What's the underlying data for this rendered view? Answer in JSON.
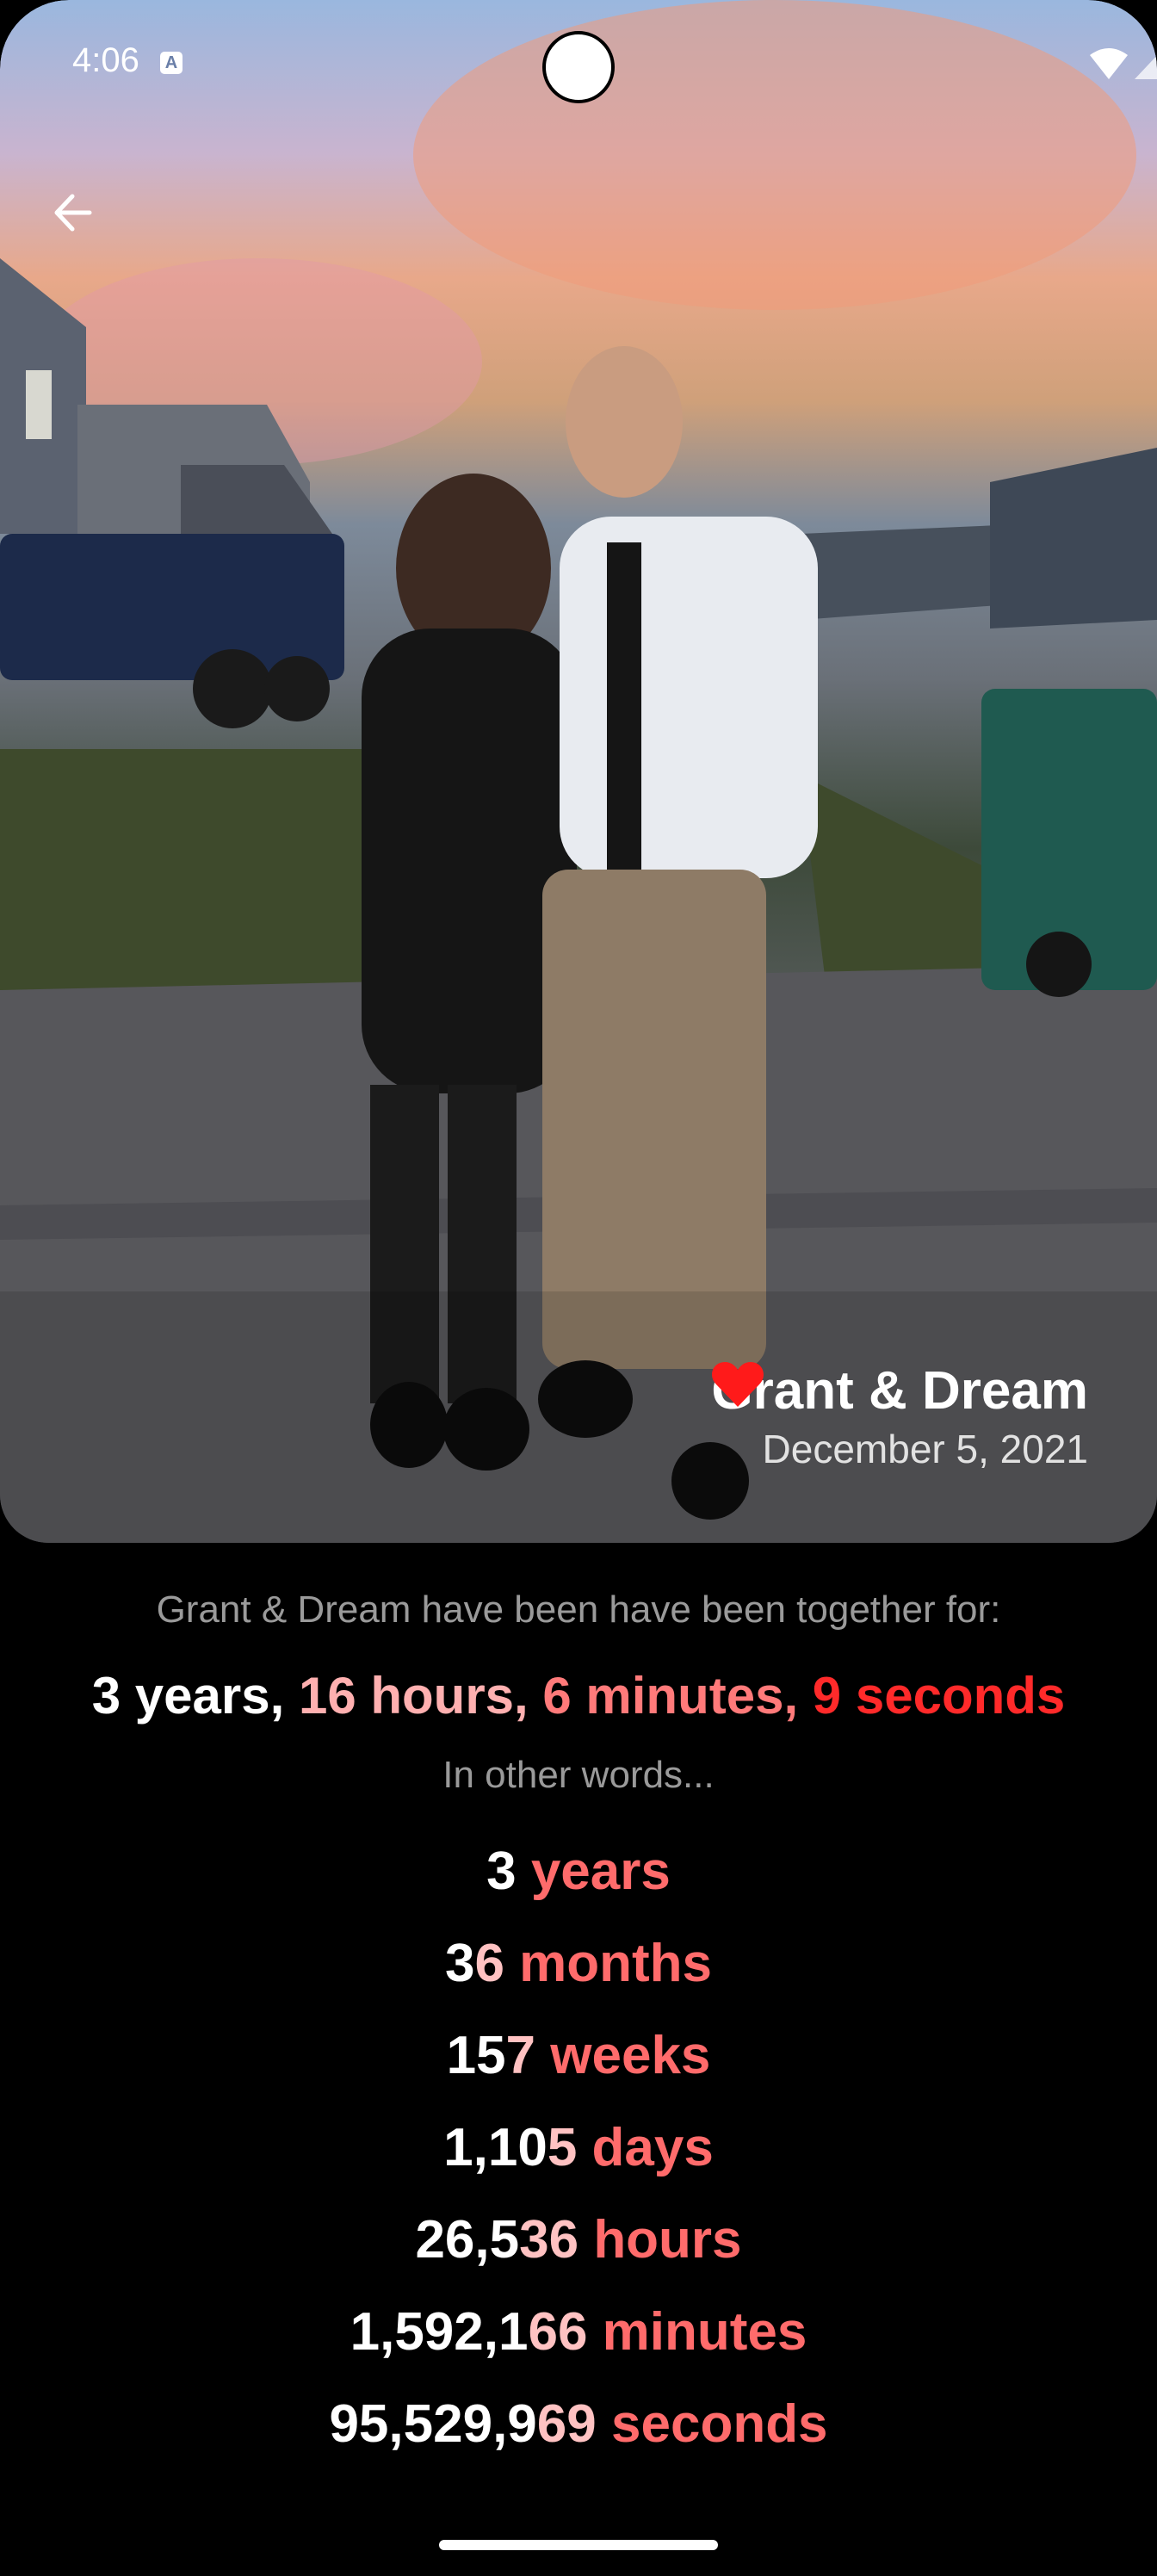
{
  "status_bar": {
    "time": "4:06",
    "notification_icon": "a-text-icon",
    "icons": [
      "wifi-icon",
      "signal-icon",
      "battery-icon"
    ]
  },
  "hero": {
    "back_icon": "arrow-left-icon",
    "couple_name": "Grant & Dream",
    "heart_icon": "heart-icon",
    "date": "December 5, 2021"
  },
  "together": {
    "intro": "Grant & Dream have been have been together for:",
    "summary": [
      {
        "text": "3 years, ",
        "tone": "white"
      },
      {
        "text": "16 hours, ",
        "tone": "pink"
      },
      {
        "text": "6 minutes, ",
        "tone": "salmon"
      },
      {
        "text": "9 seconds",
        "tone": "red"
      }
    ],
    "other_words": "In other words...",
    "units": [
      {
        "prefix": "3",
        "suffix": "",
        "unit": "years"
      },
      {
        "prefix": "3",
        "suffix": "6",
        "unit": "months"
      },
      {
        "prefix": "15",
        "suffix": "7",
        "unit": "weeks"
      },
      {
        "prefix": "1,10",
        "suffix": "5",
        "unit": "days"
      },
      {
        "prefix": "26,5",
        "suffix": "36",
        "unit": "hours"
      },
      {
        "prefix": "1,592,1",
        "suffix": "66",
        "unit": "minutes"
      },
      {
        "prefix": "95,529,9",
        "suffix": "69",
        "unit": "seconds"
      }
    ]
  },
  "colors": {
    "accent_red": "#ff2a2a",
    "accent_salmon": "#ff6b6b",
    "background": "#000000"
  }
}
